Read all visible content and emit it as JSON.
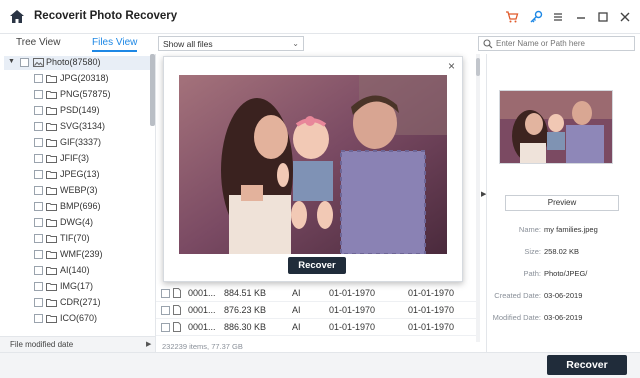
{
  "app": {
    "title": "Recoverit Photo Recovery"
  },
  "toolbar": {
    "tabs": [
      {
        "label": "Tree View"
      },
      {
        "label": "Files View"
      }
    ],
    "filter_value": "Show all files",
    "search_placeholder": "Enter Name or Path here"
  },
  "tree": {
    "root_label": "Photo(87580)",
    "items": [
      {
        "label": "JPG(20318)"
      },
      {
        "label": "PNG(57875)"
      },
      {
        "label": "PSD(149)"
      },
      {
        "label": "SVG(3134)"
      },
      {
        "label": "GIF(3337)"
      },
      {
        "label": "JFIF(3)"
      },
      {
        "label": "JPEG(13)"
      },
      {
        "label": "WEBP(3)"
      },
      {
        "label": "BMP(696)"
      },
      {
        "label": "DWG(4)"
      },
      {
        "label": "TIF(70)"
      },
      {
        "label": "WMF(239)"
      },
      {
        "label": "AI(140)"
      },
      {
        "label": "IMG(17)"
      },
      {
        "label": "CDR(271)"
      },
      {
        "label": "ICO(670)"
      }
    ],
    "footer_label": "File modified date"
  },
  "files": {
    "rows": [
      {
        "name": "0001...",
        "size": "884.51  KB",
        "type": "AI",
        "created": "01-01-1970",
        "modified": "01-01-1970"
      },
      {
        "name": "0001...",
        "size": "876.23  KB",
        "type": "AI",
        "created": "01-01-1970",
        "modified": "01-01-1970"
      },
      {
        "name": "0001...",
        "size": "886.30  KB",
        "type": "AI",
        "created": "01-01-1970",
        "modified": "01-01-1970"
      }
    ],
    "status": "232239 items, 77.37  GB"
  },
  "preview_modal": {
    "close_glyph": "×",
    "recover_label": "Recover"
  },
  "details": {
    "preview_label": "Preview",
    "fields": [
      {
        "label": "Name:",
        "value": "my families.jpeg"
      },
      {
        "label": "Size:",
        "value": "258.02  KB"
      },
      {
        "label": "Path:",
        "value": "Photo/JPEG/"
      },
      {
        "label": "Created Date:",
        "value": "03-06-2019"
      },
      {
        "label": "Modified Date:",
        "value": "03-06-2019"
      }
    ]
  },
  "footer": {
    "recover_label": "Recover"
  },
  "colors": {
    "accent": "#1e88e5",
    "dark_button": "#202c3a",
    "cart_icon": "#e05a2b",
    "key_icon": "#1e88e5"
  },
  "icons": [
    "home-icon",
    "cart-icon",
    "key-icon",
    "menu-icon",
    "minimize-icon",
    "maximize-icon",
    "close-icon",
    "search-icon",
    "folder-icon",
    "file-icon",
    "list-view-icon",
    "grid-view-icon"
  ]
}
